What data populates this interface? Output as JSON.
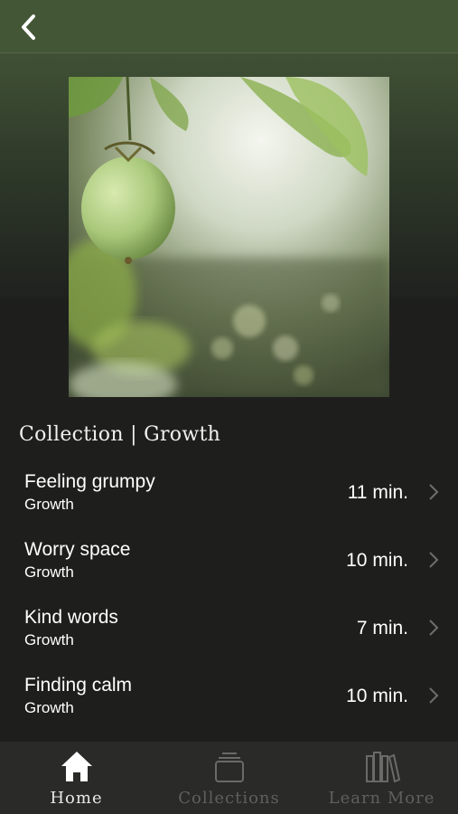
{
  "header": {
    "back_icon": "chevron-left-icon"
  },
  "artwork": {
    "subject": "green passion fruit hanging among leaves",
    "accent": "#9fbf6a"
  },
  "collection": {
    "title": "Collection | Growth"
  },
  "sessions": [
    {
      "title": "Feeling grumpy",
      "category": "Growth",
      "duration": "11 min."
    },
    {
      "title": "Worry space",
      "category": "Growth",
      "duration": "10 min."
    },
    {
      "title": "Kind words",
      "category": "Growth",
      "duration": "7 min."
    },
    {
      "title": "Finding calm",
      "category": "Growth",
      "duration": "10 min."
    }
  ],
  "tabbar": {
    "tabs": [
      {
        "label": "Home",
        "icon": "home-icon",
        "active": true
      },
      {
        "label": "Collections",
        "icon": "collections-stack-icon",
        "active": false
      },
      {
        "label": "Learn More",
        "icon": "books-icon",
        "active": false
      }
    ]
  },
  "colors": {
    "header_green": "#435636",
    "background": "#1e1f1d",
    "tabbar": "#2a2b28",
    "inactive_tab": "#5f605c"
  }
}
